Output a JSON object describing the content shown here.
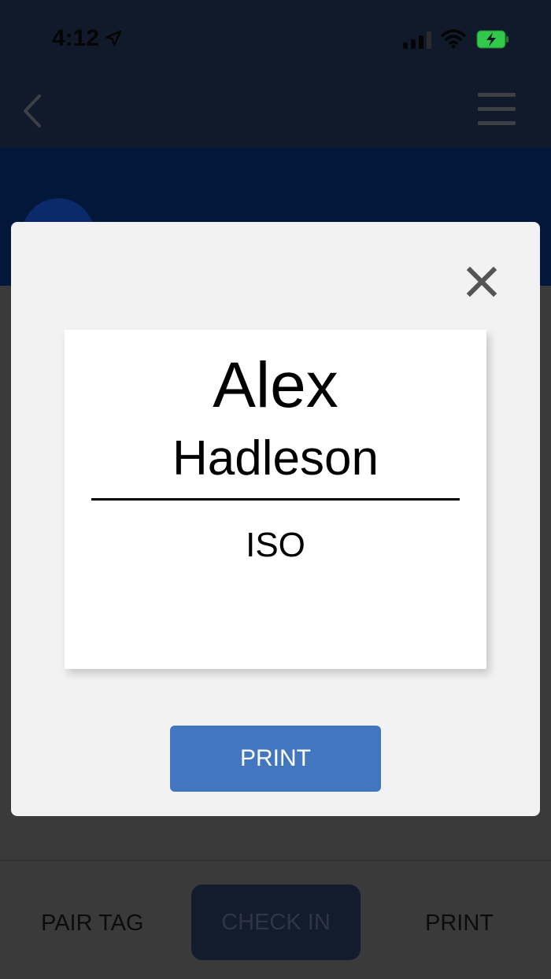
{
  "status_bar": {
    "time": "4:12",
    "icons": [
      "location-arrow-icon",
      "cellular-signal-icon",
      "wifi-icon",
      "battery-charging-icon"
    ]
  },
  "nav": {
    "back_icon": "chevron-left-icon",
    "menu_icon": "hamburger-menu-icon"
  },
  "modal": {
    "close_icon": "close-x-icon",
    "badge": {
      "first_name": "Alex",
      "last_name": "Hadleson",
      "organization": "ISO"
    },
    "print_label": "PRINT"
  },
  "bottom_bar": {
    "pair_tag_label": "PAIR TAG",
    "check_in_label": "CHECK IN",
    "print_label": "PRINT"
  },
  "colors": {
    "nav_bg": "#101a2a",
    "hero_bg": "#02173a",
    "modal_bg": "#f2f2f2",
    "print_button": "#4277c0",
    "battery": "#32c84a"
  }
}
